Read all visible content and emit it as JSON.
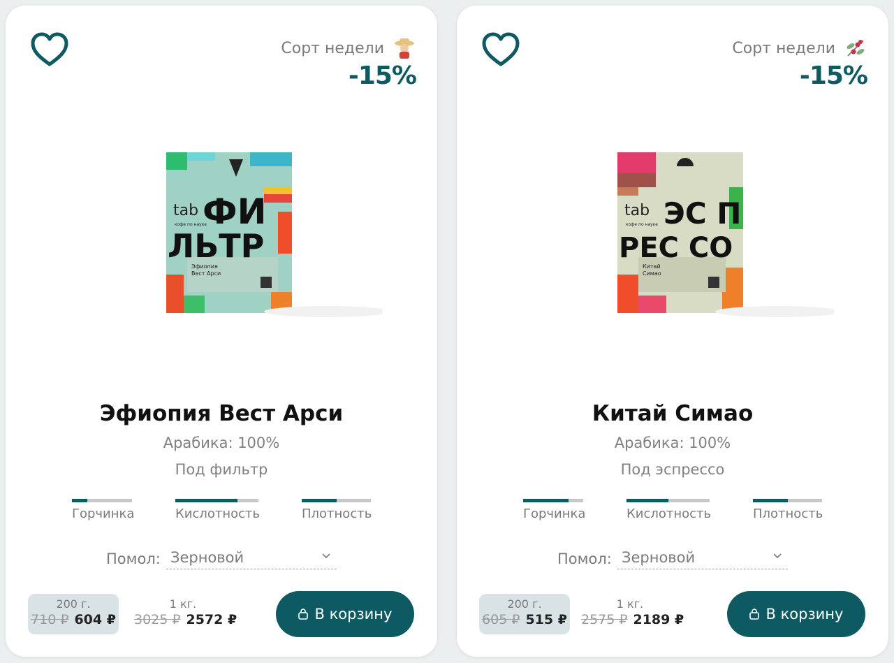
{
  "colors": {
    "accent": "#0e5a63",
    "muted": "#7a7a7a",
    "bar_bg": "#c8c8c8",
    "active_box": "#d9e3e5"
  },
  "cards": [
    {
      "badge": "Сорт недели",
      "badge_icon": "farmer-emoji-icon",
      "discount": "-15%",
      "package": {
        "brand": "tab",
        "line1": "ФИ",
        "line2": "ЛЬТР",
        "tagline": "кофе по науке",
        "origin": "Эфиопия",
        "name": "Вест Арси"
      },
      "title": "Эфиопия Вест Арси",
      "arabica": "Арабика: 100%",
      "method": "Под фильтр",
      "metrics": [
        {
          "label": "Горчинка",
          "level": 0.25
        },
        {
          "label": "Кислотность",
          "level": 0.75
        },
        {
          "label": "Плотность",
          "level": 0.5
        }
      ],
      "grind_label": "Помол:",
      "grind_value": "Зерновой",
      "price_small": {
        "weight": "200 г.",
        "old": "710 ₽",
        "new": "604 ₽"
      },
      "price_large": {
        "weight": "1 кг.",
        "old": "3025 ₽",
        "new": "2572 ₽"
      },
      "cart_label": "В корзину"
    },
    {
      "badge": "Сорт недели",
      "badge_icon": "berries-emoji-icon",
      "discount": "-15%",
      "package": {
        "brand": "tab",
        "line1": "ЭС П",
        "line2": "РЕС СО",
        "tagline": "кофе по науке",
        "origin": "Китай",
        "name": "Симао"
      },
      "title": "Китай Симао",
      "arabica": "Арабика: 100%",
      "method": "Под эспрессо",
      "metrics": [
        {
          "label": "Горчинка",
          "level": 0.75
        },
        {
          "label": "Кислотность",
          "level": 0.5
        },
        {
          "label": "Плотность",
          "level": 0.5
        }
      ],
      "grind_label": "Помол:",
      "grind_value": "Зерновой",
      "price_small": {
        "weight": "200 г.",
        "old": "605 ₽",
        "new": "515 ₽"
      },
      "price_large": {
        "weight": "1 кг.",
        "old": "2575 ₽",
        "new": "2189 ₽"
      },
      "cart_label": "В корзину"
    }
  ]
}
